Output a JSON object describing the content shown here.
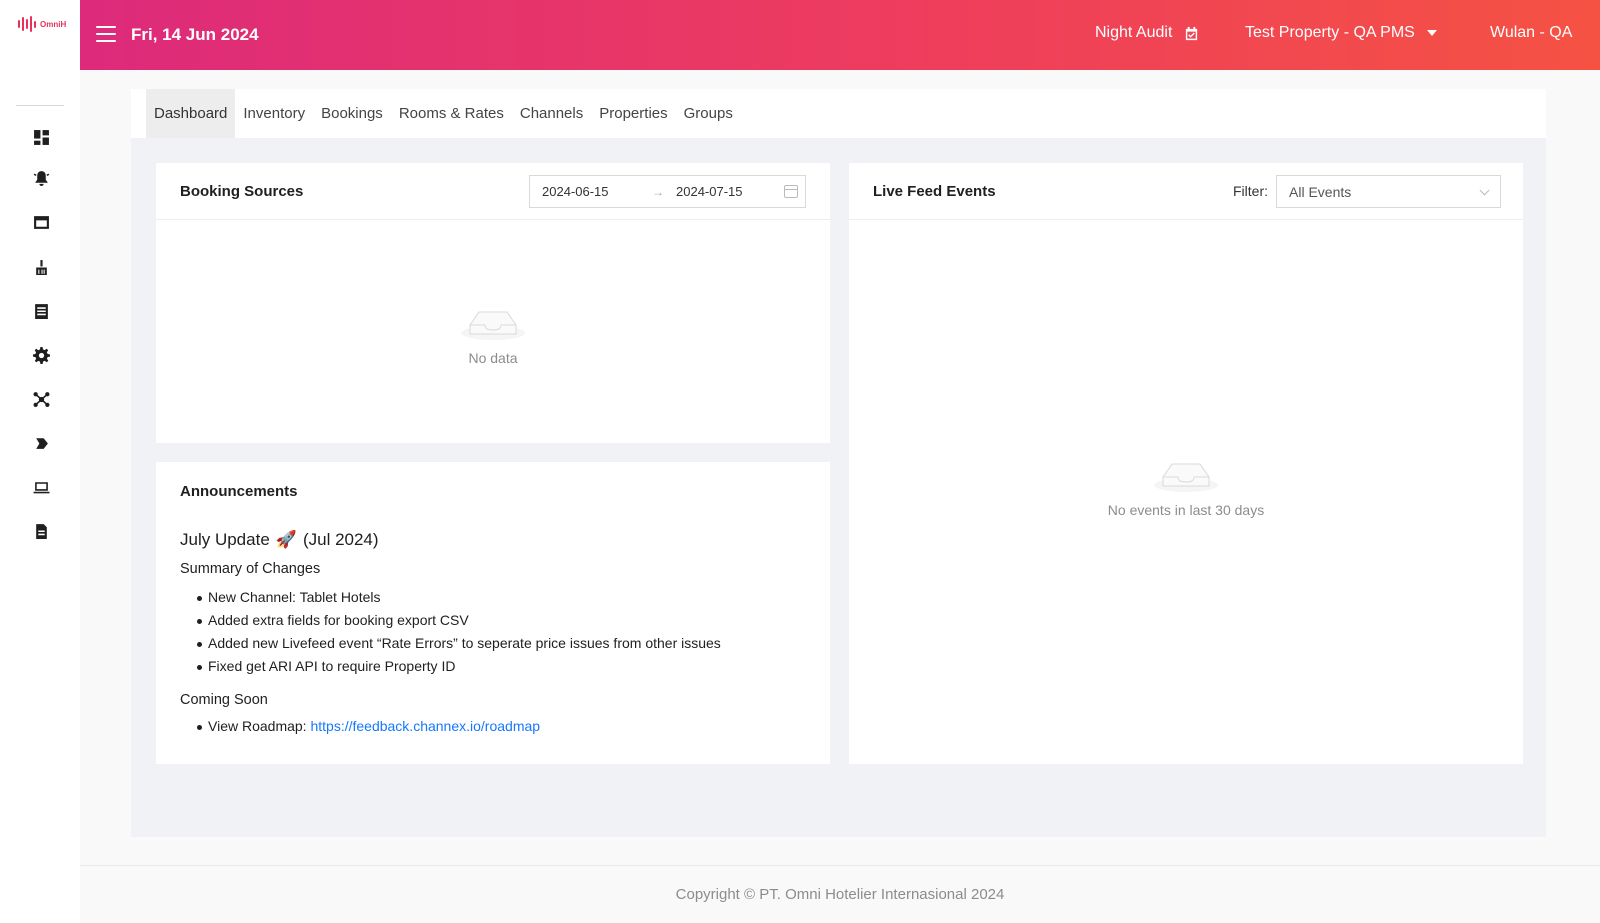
{
  "app": {
    "logo_text": "OmniH"
  },
  "sidebar": {
    "icons": [
      {
        "name": "dashboard-icon"
      },
      {
        "name": "bell-alert-icon"
      },
      {
        "name": "window-icon"
      },
      {
        "name": "broom-icon"
      },
      {
        "name": "list-icon"
      },
      {
        "name": "gear-icon"
      },
      {
        "name": "network-icon"
      },
      {
        "name": "tag-icon"
      },
      {
        "name": "laptop-icon"
      },
      {
        "name": "report-icon"
      }
    ]
  },
  "header": {
    "date": "Fri, 14 Jun 2024",
    "night_audit": "Night Audit",
    "property": "Test Property - QA PMS",
    "user": "Wulan - QA"
  },
  "tabs": [
    {
      "label": "Dashboard",
      "active": true
    },
    {
      "label": "Inventory"
    },
    {
      "label": "Bookings"
    },
    {
      "label": "Rooms & Rates"
    },
    {
      "label": "Channels"
    },
    {
      "label": "Properties"
    },
    {
      "label": "Groups"
    }
  ],
  "booking_sources": {
    "title": "Booking Sources",
    "date_from": "2024-06-15",
    "date_arrow": "→",
    "date_to": "2024-07-15",
    "empty_text": "No data"
  },
  "announcements": {
    "title": "Announcements",
    "update_title": "July Update",
    "update_emoji": "🚀",
    "update_date": "(Jul 2024)",
    "summary_heading": "Summary of Changes",
    "changes": [
      "New Channel: Tablet Hotels",
      "Added extra fields for booking export CSV",
      "Added new Livefeed event “Rate Errors” to seperate price issues from other issues",
      "Fixed get ARI API to require Property ID"
    ],
    "coming_heading": "Coming Soon",
    "roadmap_label": "View Roadmap: ",
    "roadmap_link": "https://feedback.channex.io/roadmap"
  },
  "live_feed": {
    "title": "Live Feed Events",
    "filter_label": "Filter:",
    "filter_value": "All Events",
    "empty_text": "No events in last 30 days"
  },
  "footer": {
    "copyright": "Copyright © PT. Omni Hotelier Internasional 2024"
  },
  "colors": {
    "accent_start": "#dd2a7b",
    "accent_end": "#f55243",
    "link": "#1677ff"
  }
}
